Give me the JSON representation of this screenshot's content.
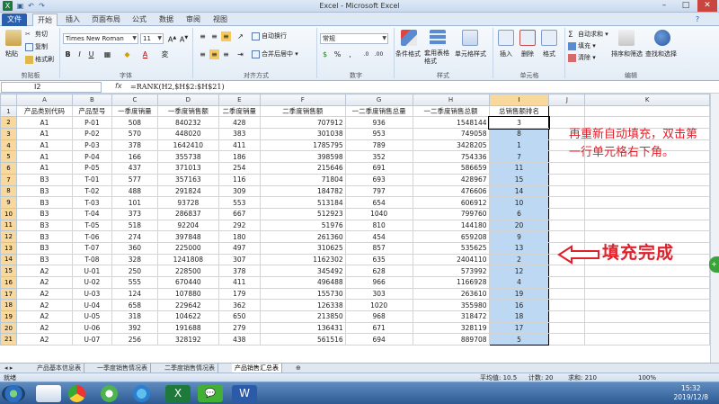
{
  "app": {
    "title": "Excel - Microsoft Excel"
  },
  "tabs": [
    "文件",
    "开始",
    "插入",
    "页面布局",
    "公式",
    "数据",
    "审阅",
    "视图"
  ],
  "ribbon": {
    "clipboard": {
      "paste": "粘贴",
      "cut": "剪切",
      "copy": "复制",
      "format_painter": "格式刷",
      "label": "剪贴板"
    },
    "font": {
      "name": "Times New Roman",
      "size": "11",
      "bold": "B",
      "italic": "I",
      "underline": "U",
      "font_color": "A",
      "label": "字体"
    },
    "alignment": {
      "wrap": "自动换行",
      "merge": "合并后居中",
      "label": "对齐方式"
    },
    "number": {
      "format": "常规",
      "label": "数字"
    },
    "styles": {
      "conditional": "条件格式",
      "table": "套用表格格式",
      "cell": "单元格样式",
      "label": "样式"
    },
    "cells": {
      "insert": "插入",
      "delete": "删除",
      "format": "格式",
      "label": "单元格"
    },
    "editing": {
      "autosum": "自动求和",
      "fill": "填充",
      "clear": "清除",
      "sort": "排序和筛选",
      "find": "查找和选择",
      "label": "编辑"
    }
  },
  "formula_bar": {
    "name_box": "I2",
    "fx": "fx",
    "formula": "=RANK(H2,$H$2:$H$21)"
  },
  "columns": [
    "A",
    "B",
    "C",
    "D",
    "E",
    "F",
    "G",
    "H",
    "I",
    "J",
    "K"
  ],
  "headers": [
    "产品类别代码",
    "产品型号",
    "一季度销量",
    "一季度销售额",
    "二季度销量",
    "二季度销售额",
    "一二季度销售总量",
    "一二季度销售总额",
    "总销售额排名",
    "",
    ""
  ],
  "rows": [
    [
      "A1",
      "P-01",
      "508",
      "840232",
      "428",
      "707912",
      "936",
      "1548144",
      "3"
    ],
    [
      "A1",
      "P-02",
      "570",
      "448020",
      "383",
      "301038",
      "953",
      "749058",
      "8"
    ],
    [
      "A1",
      "P-03",
      "378",
      "1642410",
      "411",
      "1785795",
      "789",
      "3428205",
      "1"
    ],
    [
      "A1",
      "P-04",
      "166",
      "355738",
      "186",
      "398598",
      "352",
      "754336",
      "7"
    ],
    [
      "A1",
      "P-05",
      "437",
      "371013",
      "254",
      "215646",
      "691",
      "586659",
      "11"
    ],
    [
      "B3",
      "T-01",
      "577",
      "357163",
      "116",
      "71804",
      "693",
      "428967",
      "15"
    ],
    [
      "B3",
      "T-02",
      "488",
      "291824",
      "309",
      "184782",
      "797",
      "476606",
      "14"
    ],
    [
      "B3",
      "T-03",
      "101",
      "93728",
      "553",
      "513184",
      "654",
      "606912",
      "10"
    ],
    [
      "B3",
      "T-04",
      "373",
      "286837",
      "667",
      "512923",
      "1040",
      "799760",
      "6"
    ],
    [
      "B3",
      "T-05",
      "518",
      "92204",
      "292",
      "51976",
      "810",
      "144180",
      "20"
    ],
    [
      "B3",
      "T-06",
      "274",
      "397848",
      "180",
      "261360",
      "454",
      "659208",
      "9"
    ],
    [
      "B3",
      "T-07",
      "360",
      "225000",
      "497",
      "310625",
      "857",
      "535625",
      "13"
    ],
    [
      "B3",
      "T-08",
      "328",
      "1241808",
      "307",
      "1162302",
      "635",
      "2404110",
      "2"
    ],
    [
      "A2",
      "U-01",
      "250",
      "228500",
      "378",
      "345492",
      "628",
      "573992",
      "12"
    ],
    [
      "A2",
      "U-02",
      "555",
      "670440",
      "411",
      "496488",
      "966",
      "1166928",
      "4"
    ],
    [
      "A2",
      "U-03",
      "124",
      "107880",
      "179",
      "155730",
      "303",
      "263610",
      "19"
    ],
    [
      "A2",
      "U-04",
      "658",
      "229642",
      "362",
      "126338",
      "1020",
      "355980",
      "16"
    ],
    [
      "A2",
      "U-05",
      "318",
      "104622",
      "650",
      "213850",
      "968",
      "318472",
      "18"
    ],
    [
      "A2",
      "U-06",
      "392",
      "191688",
      "279",
      "136431",
      "671",
      "328119",
      "17"
    ],
    [
      "A2",
      "U-07",
      "256",
      "328192",
      "438",
      "561516",
      "694",
      "889708",
      "5"
    ]
  ],
  "annotations": {
    "note1": "再重新自动填充，双击第一行单元格右下角。",
    "note2": "填充完成"
  },
  "sheet_tabs": [
    "产品基本信息表",
    "一季度销售情况表",
    "二季度销售情况表",
    "产品销售汇总表"
  ],
  "status": {
    "left": "就绪",
    "average": "平均值: 10.5",
    "count": "计数: 20",
    "sum": "求和: 210",
    "zoom": "100%"
  },
  "clock": {
    "time": "15:32",
    "date": "2019/12/8"
  },
  "colors": {
    "accent": "#2a5fae",
    "selection": "#bcd8f3",
    "annotation": "#e0202a"
  }
}
